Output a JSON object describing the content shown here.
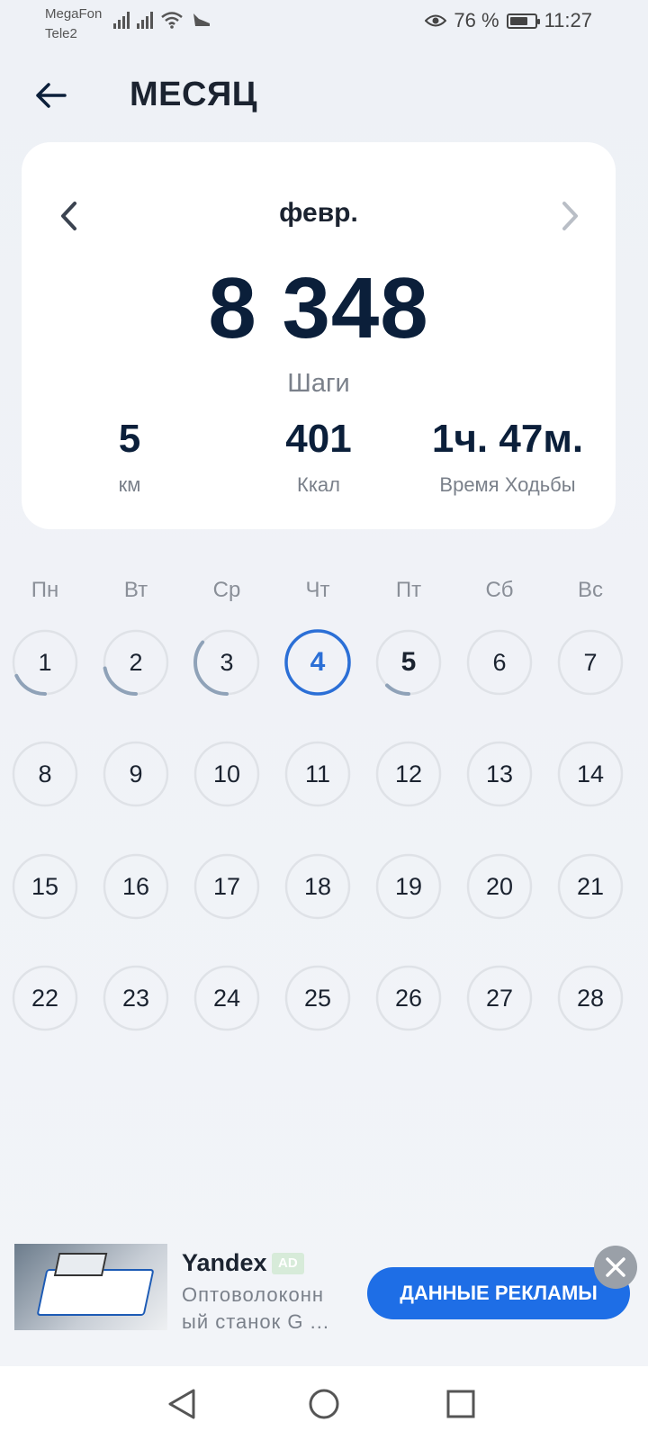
{
  "status_bar": {
    "carrier1": "MegaFon",
    "carrier2": "Tele2",
    "battery_percent": "76 %",
    "battery_level": 0.76,
    "time": "11:27"
  },
  "header": {
    "title": "МЕСЯЦ"
  },
  "summary": {
    "month": "февр.",
    "steps_value": "8 348",
    "steps_label": "Шаги",
    "distance_value": "5",
    "distance_label": "км",
    "kcal_value": "401",
    "kcal_label": "Ккал",
    "time_value": "1ч. 47м.",
    "time_label": "Время Ходьбы"
  },
  "calendar": {
    "weekdays": [
      "Пн",
      "Вт",
      "Ср",
      "Чт",
      "Пт",
      "Сб",
      "Вс"
    ],
    "days": [
      {
        "n": "1",
        "progress": 0.18
      },
      {
        "n": "2",
        "progress": 0.22
      },
      {
        "n": "3",
        "progress": 0.36
      },
      {
        "n": "4",
        "progress": 0,
        "today": true
      },
      {
        "n": "5",
        "progress": 0.12,
        "bold": true
      },
      {
        "n": "6",
        "progress": 0
      },
      {
        "n": "7",
        "progress": 0
      },
      {
        "n": "8",
        "progress": 0
      },
      {
        "n": "9",
        "progress": 0
      },
      {
        "n": "10",
        "progress": 0
      },
      {
        "n": "11",
        "progress": 0
      },
      {
        "n": "12",
        "progress": 0
      },
      {
        "n": "13",
        "progress": 0
      },
      {
        "n": "14",
        "progress": 0
      },
      {
        "n": "15",
        "progress": 0
      },
      {
        "n": "16",
        "progress": 0
      },
      {
        "n": "17",
        "progress": 0
      },
      {
        "n": "18",
        "progress": 0
      },
      {
        "n": "19",
        "progress": 0
      },
      {
        "n": "20",
        "progress": 0
      },
      {
        "n": "21",
        "progress": 0
      },
      {
        "n": "22",
        "progress": 0
      },
      {
        "n": "23",
        "progress": 0
      },
      {
        "n": "24",
        "progress": 0
      },
      {
        "n": "25",
        "progress": 0
      },
      {
        "n": "26",
        "progress": 0
      },
      {
        "n": "27",
        "progress": 0
      },
      {
        "n": "28",
        "progress": 0
      }
    ]
  },
  "ad": {
    "brand": "Yandex",
    "tag": "AD",
    "text": "Оптоволоконн ый станок G ...",
    "button": "ДАННЫЕ РЕКЛАМЫ"
  },
  "colors": {
    "accent": "#2b6fd6",
    "progress_arc": "#8fa2b8",
    "ring": "#dfe2e7",
    "ad_button": "#1e6ee6"
  },
  "icons": {
    "back": "arrow-left-icon",
    "prev": "chevron-left-icon",
    "next": "chevron-right-icon",
    "close": "close-icon",
    "nav_back": "triangle-back-icon",
    "nav_home": "circle-home-icon",
    "nav_recent": "square-recent-icon"
  }
}
